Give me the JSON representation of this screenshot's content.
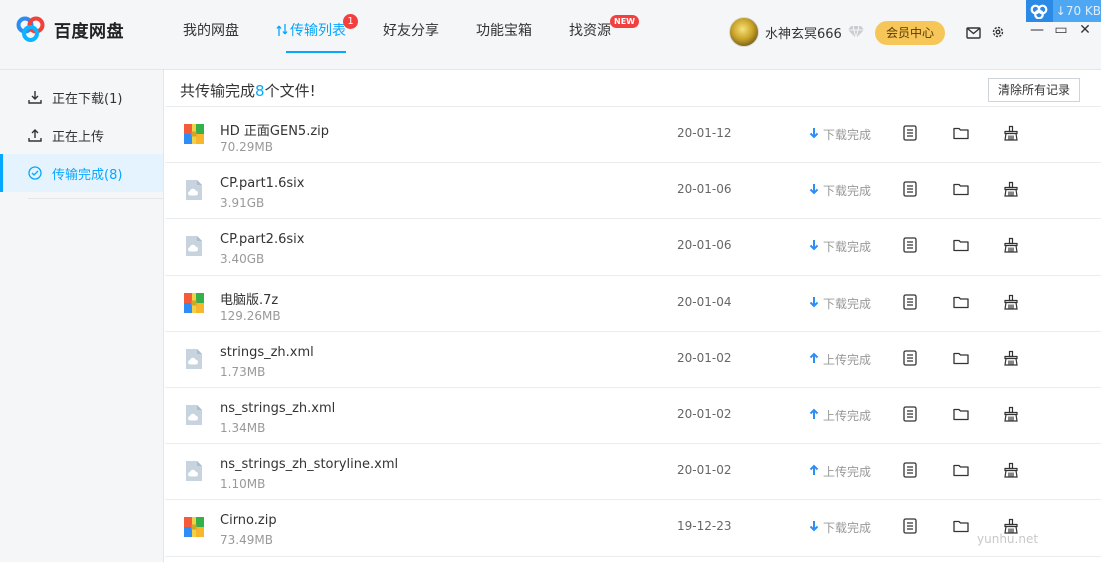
{
  "app": {
    "name": "百度网盘"
  },
  "nav": {
    "items": [
      {
        "label": "我的网盘"
      },
      {
        "label": "传输列表",
        "badge": "1"
      },
      {
        "label": "好友分享"
      },
      {
        "label": "功能宝箱"
      },
      {
        "label": "找资源",
        "badge": "NEW"
      }
    ]
  },
  "user": {
    "name": "水神玄冥666",
    "vip_button": "会员中心"
  },
  "float_widget": {
    "speed": "70 KB"
  },
  "sidebar": {
    "items": [
      {
        "label": "正在下载(1)"
      },
      {
        "label": "正在上传"
      },
      {
        "label": "传输完成(8)"
      }
    ]
  },
  "main": {
    "summary_prefix": "共传输完成",
    "summary_count": "8",
    "summary_suffix": "个文件!",
    "clear_button": "清除所有记录"
  },
  "files": [
    {
      "name": "HD 正面GEN5.zip",
      "size": "70.29MB",
      "date": "20-01-12",
      "status": "下载完成",
      "type": "archive",
      "direction": "download"
    },
    {
      "name": "CP.part1.6six",
      "size": "3.91GB",
      "date": "20-01-06",
      "status": "下载完成",
      "type": "generic",
      "direction": "download"
    },
    {
      "name": "CP.part2.6six",
      "size": "3.40GB",
      "date": "20-01-06",
      "status": "下载完成",
      "type": "generic",
      "direction": "download"
    },
    {
      "name": "电脑版.7z",
      "size": "129.26MB",
      "date": "20-01-04",
      "status": "下载完成",
      "type": "archive",
      "direction": "download"
    },
    {
      "name": "strings_zh.xml",
      "size": "1.73MB",
      "date": "20-01-02",
      "status": "上传完成",
      "type": "generic",
      "direction": "upload"
    },
    {
      "name": "ns_strings_zh.xml",
      "size": "1.34MB",
      "date": "20-01-02",
      "status": "上传完成",
      "type": "generic",
      "direction": "upload"
    },
    {
      "name": "ns_strings_zh_storyline.xml",
      "size": "1.10MB",
      "date": "20-01-02",
      "status": "上传完成",
      "type": "generic",
      "direction": "upload"
    },
    {
      "name": "Cirno.zip",
      "size": "73.49MB",
      "date": "19-12-23",
      "status": "下载完成",
      "type": "archive",
      "direction": "download"
    }
  ],
  "watermark": "yunhu.net",
  "colors": {
    "accent": "#06a7ff",
    "badge": "#f43f3f",
    "vip": "#f7c659",
    "sidebar_bg": "#f5f6f8"
  }
}
